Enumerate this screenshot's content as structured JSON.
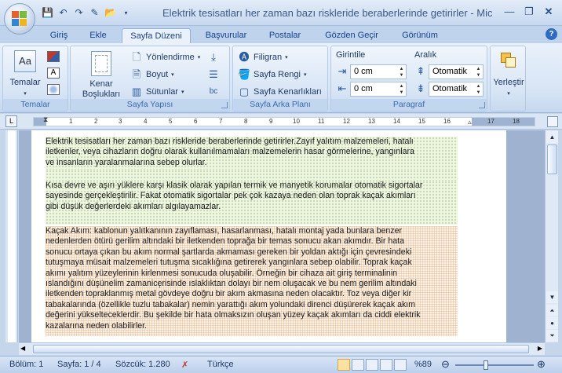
{
  "window": {
    "title": "Elektrik tesisatları her zaman bazı riskleride beraberlerinde getirirler - Microsoft Word",
    "controls": [
      "minimize",
      "maximize",
      "close"
    ]
  },
  "quick_access": [
    "save-icon",
    "undo-icon",
    "redo-icon",
    "edit-icon",
    "open-icon"
  ],
  "tabs": [
    "Giriş",
    "Ekle",
    "Sayfa Düzeni",
    "Başvurular",
    "Postalar",
    "Gözden Geçir",
    "Görünüm"
  ],
  "active_tab": "Sayfa Düzeni",
  "ribbon": {
    "temalar": {
      "label": "Temalar",
      "big": "Temalar"
    },
    "sayfa_yapisi": {
      "label": "Sayfa Yapısı",
      "kenar": "Kenar",
      "bosluklari": "Boşlukları",
      "yonlendirme": "Yönlendirme",
      "boyut": "Boyut",
      "sutunlar": "Sütunlar"
    },
    "sayfa_arka_plani": {
      "label": "Sayfa Arka Planı",
      "filigran": "Filigran",
      "sayfa_rengi": "Sayfa Rengi",
      "sayfa_kenarliklari": "Sayfa Kenarlıkları"
    },
    "paragraf": {
      "label": "Paragraf",
      "girintile": "Girintile",
      "aralik": "Aralık",
      "girinti_sol": "0 cm",
      "girinti_sag": "0 cm",
      "aralik_once": "Otomatik",
      "aralik_sonra": "Otomatik"
    },
    "yerlestir": {
      "label": "Yerleştir"
    }
  },
  "ruler_numbers": [
    "1",
    "2",
    "3",
    "4",
    "5",
    "6",
    "7",
    "8",
    "9",
    "10",
    "11",
    "12",
    "13",
    "14",
    "15",
    "16",
    "17",
    "18"
  ],
  "document": {
    "p1_lines": [
      "Elektrik tesisatları her zaman bazı riskleride beraberlerinde getirirler.Zayıf yalıtım malzemeleri, hatalı",
      "iletkenler, veya cihazların doğru olarak kullanılmamaları malzemelerin hasar görmelerine, yangınlara",
      "ve insanların yaralanmalarına sebep olurlar."
    ],
    "p2_lines": [
      "Kısa devre ve aşırı yüklere karşı klasik olarak yapılan termik ve manyetik korumalar otomatik sigortalar",
      "sayesinde gerçekleştirilir. Fakat otomatik sigortalar pek çok kazaya neden olan toprak kaçak akımları",
      "gibi düşük değerlerdeki akımları algılayamazlar."
    ],
    "p3_lines": [
      "Kaçak Akım: kablonun yalıtkanının zayıflaması, hasarlanması, hatalı montaj yada bunlara benzer",
      "nedenlerden ötürü gerilim altındaki bir iletkenden toprağa bir temas sonucu akan akımdır. Bir hata",
      "sonucu ortaya çıkan bu akım normal şartlarda akmaması gereken bir yoldan aktığı için çevresindeki",
      "tutuşmaya müsait malzemeleri tutuşma sıcaklığına getirerek yangınlara sebep olabilir. Toprak kaçak",
      "akımı yalıtım yüzeylerinin kirlenmesi sonucuda oluşabilir. Örneğin bir cihaza ait giriş terminalinin",
      "ıslandığını düşünelim zamanice̦risinde ıslaklıktan dolayı bir nem oluşacak ve bu nem gerilim altındaki",
      "iletkenden topraklanmış metal gövdeye doğru bir akım akmasına neden olacaktır. Toz veya diğer kir",
      "tabakalarında (özellikle tuzlu tabakalar) nemin yarattığı akım yolundaki direnci düşürerek kaçak akım",
      "değerini yükselteceklerdir. Bu şekilde bir hata olmaksızın oluşan yüzey kaçak akımları da ciddi elektrik",
      "kazalarına neden olabilirler."
    ]
  },
  "status": {
    "bolum": "Bölüm: 1",
    "sayfa": "Sayfa: 1 / 4",
    "sozcuk": "Sözcük: 1.280",
    "dil": "Türkçe",
    "zoom": "%89"
  },
  "colors": {
    "ribbon": "#d6e4f5",
    "tab_text": "#15428b",
    "page_bg": "#ffffff"
  }
}
